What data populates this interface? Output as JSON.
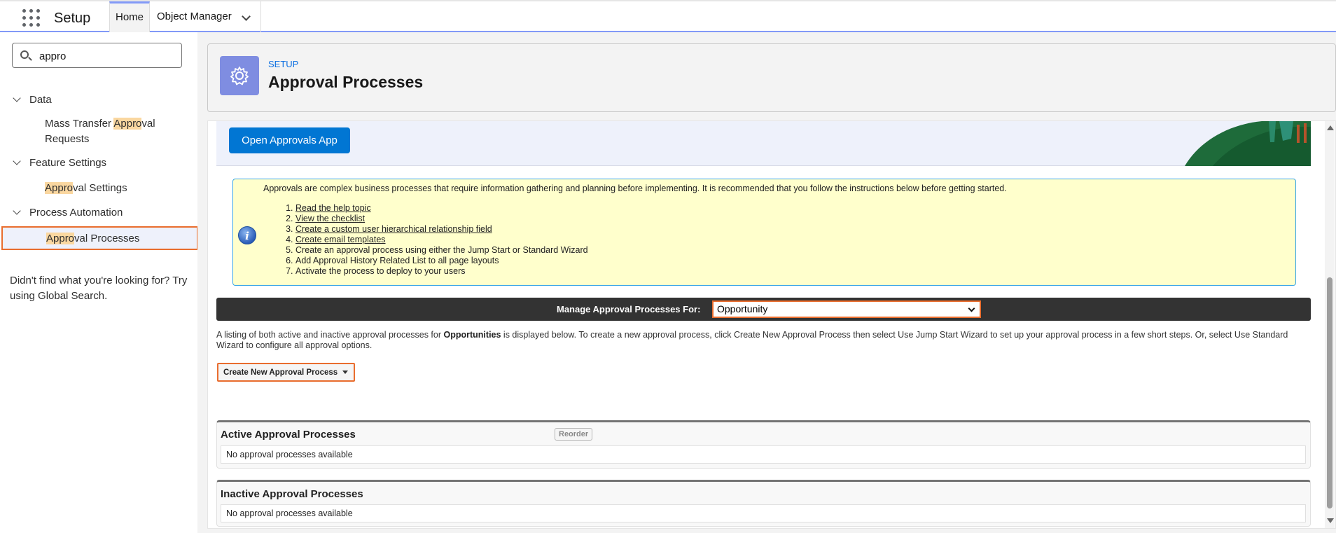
{
  "topbar": {
    "app_name": "Setup",
    "tabs": [
      {
        "label": "Home"
      },
      {
        "label": "Object Manager"
      }
    ]
  },
  "sidebar": {
    "search_value": "appro",
    "groups": [
      {
        "label": "Data",
        "items": [
          {
            "pre": "Mass Transfer ",
            "match": "Appro",
            "post": "val",
            "line2": "Requests"
          }
        ]
      },
      {
        "label": "Feature Settings",
        "items": [
          {
            "pre": "",
            "match": "Appro",
            "post": "val Settings"
          }
        ]
      },
      {
        "label": "Process Automation",
        "items": [
          {
            "pre": "",
            "match": "Appro",
            "post": "val Processes"
          }
        ]
      }
    ],
    "not_found_text": "Didn't find what you're looking for? Try using Global Search."
  },
  "header": {
    "eyebrow": "SETUP",
    "title": "Approval Processes",
    "icon": "gear-icon"
  },
  "banner": {
    "open_button": "Open Approvals App"
  },
  "info": {
    "icon": "info-icon",
    "intro": "Approvals are complex business processes that require information gathering and planning before implementing. It is recommended that you follow the instructions below before getting started.",
    "steps": [
      {
        "text": "Read the help topic",
        "link": true
      },
      {
        "text": "View the checklist",
        "link": true
      },
      {
        "text": "Create a custom user hierarchical relationship field",
        "link": true
      },
      {
        "text": "Create email templates",
        "link": true
      },
      {
        "text": "Create an approval process using either the Jump Start or Standard Wizard",
        "link": false
      },
      {
        "text": "Add Approval History Related List to all page layouts",
        "link": false
      },
      {
        "text": "Activate the process to deploy to your users",
        "link": false
      }
    ]
  },
  "manage": {
    "label": "Manage Approval Processes For:",
    "selected": "Opportunity"
  },
  "description": {
    "before": "A listing of both active and inactive approval processes for ",
    "bold": "Opportunities",
    "after": " is displayed below. To create a new approval process, click Create New Approval Process then select Use Jump Start Wizard to set up your approval process in a few short steps. Or, select Use Standard Wizard to configure all approval options."
  },
  "create_button": "Create New Approval Process",
  "sections": {
    "active": {
      "title": "Active Approval Processes",
      "reorder": "Reorder",
      "empty": "No approval processes available"
    },
    "inactive": {
      "title": "Inactive Approval Processes",
      "empty": "No approval processes available"
    }
  },
  "colors": {
    "brand_blue": "#0176d3",
    "highlight_orange": "#e96d2e",
    "search_match": "#fad7a0",
    "info_yellow": "#ffffcc"
  }
}
